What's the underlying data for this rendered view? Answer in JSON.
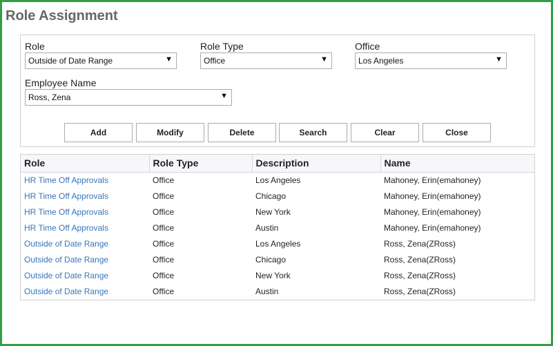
{
  "page": {
    "title": "Role Assignment"
  },
  "filters": {
    "role": {
      "label": "Role",
      "value": "Outside of Date Range"
    },
    "role_type": {
      "label": "Role Type",
      "value": "Office"
    },
    "office": {
      "label": "Office",
      "value": "Los Angeles"
    },
    "employee": {
      "label": "Employee Name",
      "value": "Ross, Zena"
    }
  },
  "buttons": {
    "add": "Add",
    "modify": "Modify",
    "delete": "Delete",
    "search": "Search",
    "clear": "Clear",
    "close": "Close"
  },
  "table": {
    "headers": [
      "Role",
      "Role Type",
      "Description",
      "Name"
    ],
    "rows": [
      [
        "HR Time Off Approvals",
        "Office",
        "Los Angeles",
        "Mahoney, Erin(emahoney)"
      ],
      [
        "HR Time Off Approvals",
        "Office",
        "Chicago",
        "Mahoney, Erin(emahoney)"
      ],
      [
        "HR Time Off Approvals",
        "Office",
        "New York",
        "Mahoney, Erin(emahoney)"
      ],
      [
        "HR Time Off Approvals",
        "Office",
        "Austin",
        "Mahoney, Erin(emahoney)"
      ],
      [
        "Outside of Date Range",
        "Office",
        "Los Angeles",
        "Ross, Zena(ZRoss)"
      ],
      [
        "Outside of Date Range",
        "Office",
        "Chicago",
        "Ross, Zena(ZRoss)"
      ],
      [
        "Outside of Date Range",
        "Office",
        "New York",
        "Ross, Zena(ZRoss)"
      ],
      [
        "Outside of Date Range",
        "Office",
        "Austin",
        "Ross, Zena(ZRoss)"
      ]
    ]
  },
  "icons": {
    "dropdown": "chevron-down-icon"
  },
  "colors": {
    "frame": "#2ea043",
    "link": "#3b73b9",
    "title": "#666666"
  }
}
